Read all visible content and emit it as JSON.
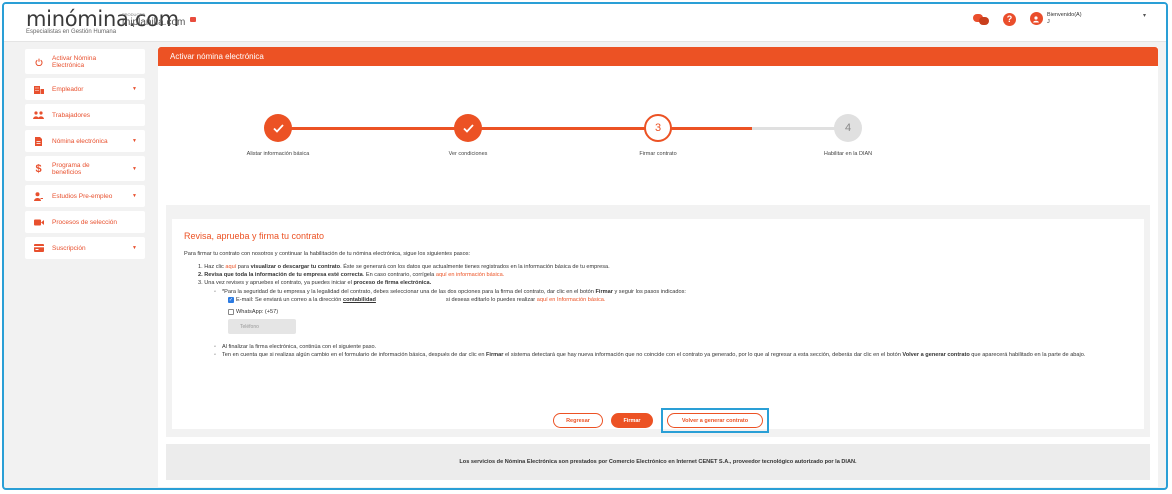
{
  "brand": {
    "name": "minómina.com",
    "tagline": "Especialistas en Gestión Humana",
    "sublogo_small": "PRODUCTO",
    "sublogo_name": "miplanilla.com"
  },
  "topbar": {
    "welcome": "Bienvenido(A)",
    "user_initial": "J",
    "help_glyph": "?"
  },
  "sidebar": {
    "items": [
      {
        "label": "Activar Nómina Electrónica",
        "icon": "power-icon",
        "caret": false
      },
      {
        "label": "Empleador",
        "icon": "building-icon",
        "caret": true
      },
      {
        "label": "Trabajadores",
        "icon": "users-icon",
        "caret": false
      },
      {
        "label": "Nómina electrónica",
        "icon": "document-icon",
        "caret": true
      },
      {
        "label": "Programa de beneficios",
        "icon": "dollar-icon",
        "caret": true
      },
      {
        "label": "Estudios Pre-empleo",
        "icon": "user-check-icon",
        "caret": true
      },
      {
        "label": "Procesos de selección",
        "icon": "video-icon",
        "caret": false
      },
      {
        "label": "Suscripción",
        "icon": "card-icon",
        "caret": true
      }
    ]
  },
  "page": {
    "header": "Activar nómina electrónica"
  },
  "steps": [
    {
      "number": "1",
      "label": "Alistar información básica",
      "state": "done"
    },
    {
      "number": "2",
      "label": "Ver condiciones",
      "state": "done"
    },
    {
      "number": "3",
      "label": "Firmar contrato",
      "state": "current"
    },
    {
      "number": "4",
      "label": "Habilitar en la DIAN",
      "state": "todo"
    }
  ],
  "contract": {
    "title": "Revisa, aprueba y firma tu contrato",
    "intro": "Para firmar tu contrato con nosotros y continuar la habilitación de tu nómina electrónica, sigue los siguientes pasos:",
    "step1_a": "1. Haz clic ",
    "step1_link": "aquí",
    "step1_b": " para ",
    "step1_bold": "visualizar o descargar tu contrato",
    "step1_c": ". Éste se generará con los datos que actualmente tienes registrados en la información básica de tu empresa.",
    "step2_bold": "2. Revisa que toda la información de tu empresa esté correcta",
    "step2_a": ". En caso contrario, corrígela ",
    "step2_link": "aquí en información básica.",
    "step3_a": "3. Una vez revises y apruebes el contrato, ya puedes iniciar el ",
    "step3_bold": "proceso de firma electrónica.",
    "bullet1_a": "*Para la seguridad de tu empresa y la legalidad del contrato, debes seleccionar una de las dos opciones para la firma del contrato, dar clic en el botón ",
    "bullet1_bold": "Firmar",
    "bullet1_b": " y seguir los pasos indicados:",
    "email_a": "E-mail: Se enviará un correo a la dirección ",
    "email_addr": "contabilidad",
    "email_b": " si deseas editarlo lo puedes realizar ",
    "email_link": "aquí en Información básica.",
    "whatsapp": "WhatsApp: (+57)",
    "phone_placeholder": "Teléfono",
    "bullet2": "Al finalizar la firma electrónica, continúa con el siguiente paso.",
    "bullet3_a": "Ten en cuenta que si realizas algún cambio en el formulario de información básica, después de dar clic en ",
    "bullet3_bold1": "Firmar",
    "bullet3_b": " el sistema detectará que hay nueva información que no coincide con el contrato ya generado, por lo que al regresar a esta sección, deberás dar clic en el botón ",
    "bullet3_bold2": "Volver a generar contrato",
    "bullet3_c": " que aparecerá habilitado en la parte de abajo."
  },
  "buttons": {
    "back": "Regresar",
    "sign": "Firmar",
    "regenerate": "Volver a generar contrato"
  },
  "footer": "Los servicios de Nómina Electrónica son prestados por Comercio Electrónico en Internet CENET S.A., proveedor tecnológico autorizado por la DIAN.",
  "colors": {
    "accent": "#ec5224",
    "highlight": "#2a9fd6"
  }
}
